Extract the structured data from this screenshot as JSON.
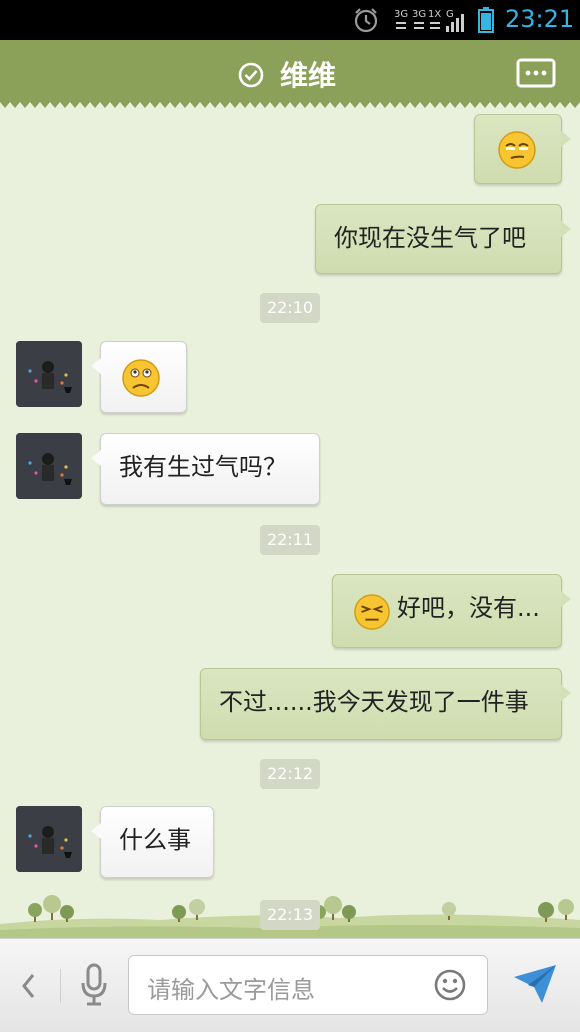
{
  "status_bar": {
    "network_labels": [
      "3G",
      "3G",
      "1X",
      "G"
    ],
    "time": "23:21"
  },
  "header": {
    "title": "维维",
    "verified_icon": "check-circle-icon",
    "more_icon": "chat-more-icon"
  },
  "messages": [
    {
      "side": "out",
      "type": "emoji",
      "emoji": "smirk-face"
    },
    {
      "side": "out",
      "type": "text",
      "text": "你现在没生气了吧"
    },
    {
      "side": "time",
      "text": "22:10"
    },
    {
      "side": "in",
      "type": "emoji",
      "emoji": "worried-face"
    },
    {
      "side": "in",
      "type": "text",
      "text": "我有生过气吗？"
    },
    {
      "side": "time",
      "text": "22:11"
    },
    {
      "side": "out",
      "type": "emoji-text",
      "emoji": "squint-face",
      "text": "好吧，没有..."
    },
    {
      "side": "out",
      "type": "text",
      "text": "不过......我今天发现了一件事"
    },
    {
      "side": "time",
      "text": "22:12"
    },
    {
      "side": "in",
      "type": "text",
      "text": "什么事"
    },
    {
      "side": "time",
      "text": "22:13"
    }
  ],
  "input_bar": {
    "placeholder": "请输入文字信息",
    "back_icon": "chevron-left-icon",
    "voice_icon": "microphone-icon",
    "emoji_icon": "smiley-icon",
    "send_icon": "send-icon"
  },
  "colors": {
    "header": "#8ba059",
    "background": "#e9f0db",
    "bubble_out": "#d4e0b6",
    "bubble_in": "#ffffff",
    "clock": "#33b5e5"
  }
}
